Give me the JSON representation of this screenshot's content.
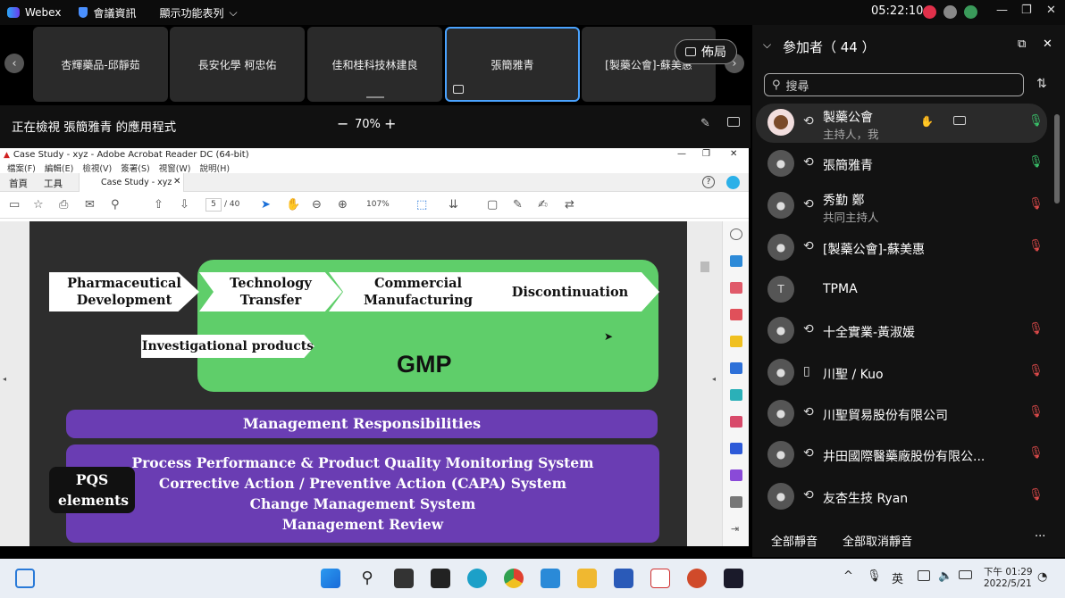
{
  "topbar": {
    "app_name": "Webex",
    "meeting_info": "會議資訊",
    "display_menu": "顯示功能表列",
    "clock": "05:22:10"
  },
  "tiles": [
    {
      "name": "杏輝藥品-邱靜茹"
    },
    {
      "name": "長安化學 柯忠佑"
    },
    {
      "name": "佳和桂科技林建良"
    },
    {
      "name": "張簡雅青"
    },
    {
      "name": "[製藥公會]-蘇美惠"
    }
  ],
  "layout_button": "佈局",
  "viewbar": {
    "viewing_text": "正在檢視 張簡雅青 的應用程式",
    "zoom_minus": "−",
    "zoom": "70%",
    "zoom_plus": "+"
  },
  "acrobat": {
    "title": "Case Study - xyz - Adobe Acrobat Reader DC (64-bit)",
    "menu": [
      "檔案(F)",
      "編輯(E)",
      "檢視(V)",
      "簽署(S)",
      "視窗(W)",
      "說明(H)"
    ],
    "tab_home": "首頁",
    "tab_tools": "工具",
    "doc_tab": "Case Study - xyz",
    "page_current": "5",
    "page_total": "/ 40",
    "zoom": "107%"
  },
  "slide": {
    "stages": [
      "Pharmaceutical Development",
      "Technology Transfer",
      "Commercial Manufacturing",
      "Discontinuation"
    ],
    "investigational": "Investigational products",
    "gmp": "GMP",
    "mgmt": "Management Responsibilities",
    "pqs_label": "PQS elements",
    "pqs_items": [
      "Process Performance & Product Quality Monitoring System",
      "Corrective Action / Preventive Action  (CAPA) System",
      "Change Management System",
      "Management Review"
    ]
  },
  "panel": {
    "title": "參加者（ 44 ）",
    "search_placeholder": "搜尋",
    "participants": [
      {
        "name": "製藥公會",
        "sub": "主持人，我",
        "mic": "on"
      },
      {
        "name": "張簡雅青",
        "sub": "",
        "mic": "on"
      },
      {
        "name": "秀勤 鄭",
        "sub": "共同主持人",
        "mic": "off"
      },
      {
        "name": "[製藥公會]-蘇美惠",
        "sub": "",
        "mic": "off"
      },
      {
        "name": "TPMA",
        "sub": "",
        "mic": "none",
        "initial": "T"
      },
      {
        "name": "十全實業-黃淑媛",
        "sub": "",
        "mic": "off"
      },
      {
        "name": "川聖 / Kuo",
        "sub": "",
        "mic": "off"
      },
      {
        "name": "川聖貿易股份有限公司",
        "sub": "",
        "mic": "off"
      },
      {
        "name": "井田國際醫藥廠股份有限公...",
        "sub": "",
        "mic": "off"
      },
      {
        "name": "友杏生技 Ryan",
        "sub": "",
        "mic": "off"
      }
    ],
    "mute_all": "全部靜音",
    "unmute_all": "全部取消靜音",
    "more": "···"
  },
  "taskbar": {
    "ime": "英",
    "time": "下午 01:29",
    "date": "2022/5/21"
  }
}
